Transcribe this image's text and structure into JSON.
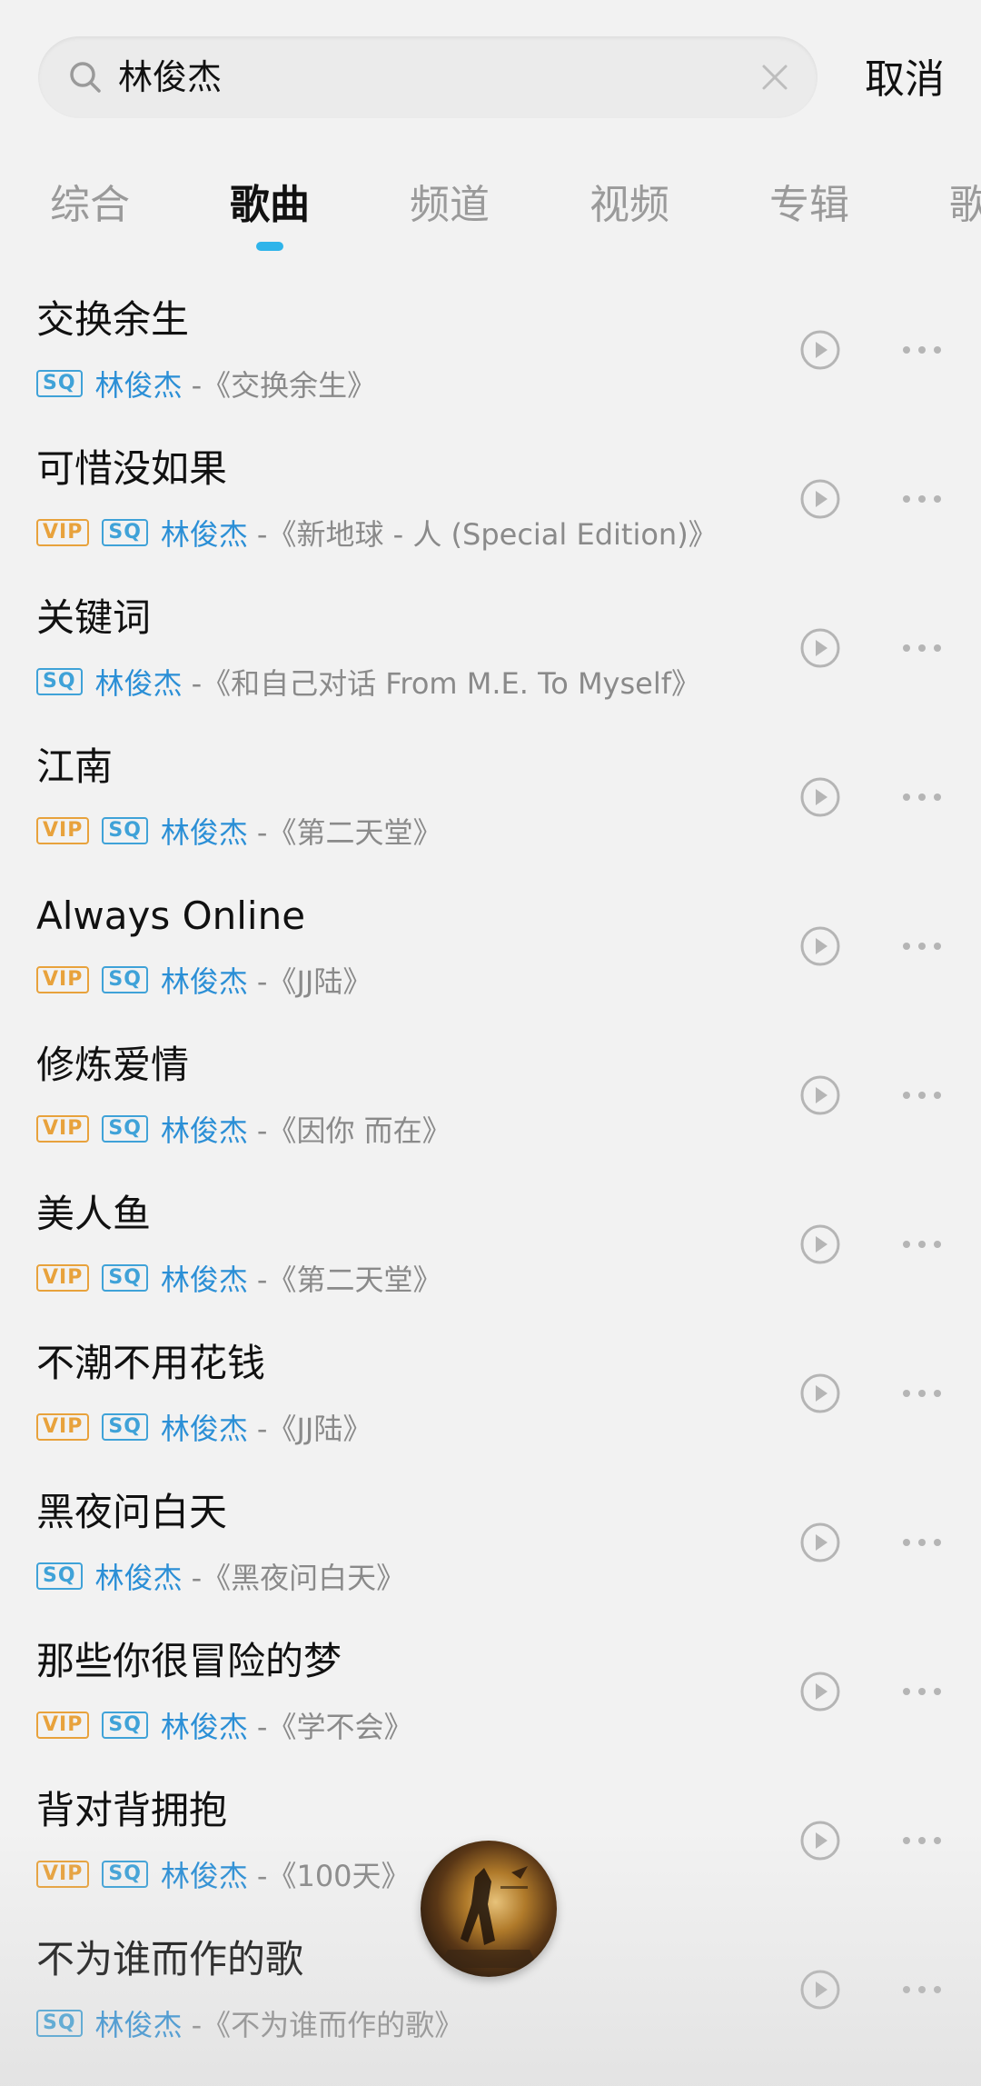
{
  "search": {
    "value": "林俊杰",
    "cancel_label": "取消"
  },
  "tabs": [
    {
      "label": "综合",
      "active": false
    },
    {
      "label": "歌曲",
      "active": true
    },
    {
      "label": "频道",
      "active": false
    },
    {
      "label": "视频",
      "active": false
    },
    {
      "label": "专辑",
      "active": false
    },
    {
      "label": "歌",
      "active": false
    }
  ],
  "songs": [
    {
      "title": "交换余生",
      "vip": false,
      "sq": true,
      "artist": "林俊杰",
      "album": "-《交换余生》"
    },
    {
      "title": "可惜没如果",
      "vip": true,
      "sq": true,
      "artist": "林俊杰",
      "album": "-《新地球 - 人 (Special Edition)》"
    },
    {
      "title": "关键词",
      "vip": false,
      "sq": true,
      "artist": "林俊杰",
      "album": "-《和自己对话 From M.E. To Myself》"
    },
    {
      "title": "江南",
      "vip": true,
      "sq": true,
      "artist": "林俊杰",
      "album": "-《第二天堂》"
    },
    {
      "title": "Always Online",
      "vip": true,
      "sq": true,
      "artist": "林俊杰",
      "album": "-《JJ陆》"
    },
    {
      "title": "修炼爱情",
      "vip": true,
      "sq": true,
      "artist": "林俊杰",
      "album": "-《因你 而在》"
    },
    {
      "title": "美人鱼",
      "vip": true,
      "sq": true,
      "artist": "林俊杰",
      "album": "-《第二天堂》"
    },
    {
      "title": "不潮不用花钱",
      "vip": true,
      "sq": true,
      "artist": "林俊杰",
      "album": "-《JJ陆》"
    },
    {
      "title": "黑夜问白天",
      "vip": false,
      "sq": true,
      "artist": "林俊杰",
      "album": "-《黑夜问白天》"
    },
    {
      "title": "那些你很冒险的梦",
      "vip": true,
      "sq": true,
      "artist": "林俊杰",
      "album": "-《学不会》"
    },
    {
      "title": "背对背拥抱",
      "vip": true,
      "sq": true,
      "artist": "林俊杰",
      "album": "-《100天》"
    },
    {
      "title": "不为谁而作的歌",
      "vip": false,
      "sq": true,
      "artist": "林俊杰",
      "album": "-《不为谁而作的歌》"
    }
  ],
  "badges": {
    "vip": "VIP",
    "sq": "SQ"
  },
  "colors": {
    "accent": "#2fb4ea",
    "artist": "#2b8fd6",
    "vip": "#e8a23c",
    "sq": "#3fa2d8"
  },
  "icons": {
    "search": "search-icon",
    "clear": "clear-icon",
    "play": "play-circle-icon",
    "more": "more-dots-icon"
  }
}
